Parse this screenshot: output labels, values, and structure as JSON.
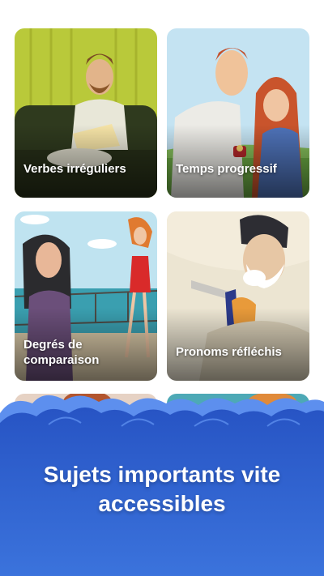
{
  "cards": [
    {
      "label": "Verbes irréguliers",
      "image": "man-reading-book-on-sofa"
    },
    {
      "label": "Temps progressif",
      "image": "man-proposing-ring-to-woman"
    },
    {
      "label": "Degrés de\ncomparaison",
      "image": "two-women-on-ship-deck"
    },
    {
      "label": "Pronoms réfléchis",
      "image": "man-shaving-with-razor"
    },
    {
      "label": "",
      "image": "partial-card-orange"
    },
    {
      "label": "",
      "image": "partial-card-teal"
    }
  ],
  "banner": {
    "title_line1": "Sujets importants vite",
    "title_line2": "accessibles"
  },
  "colors": {
    "banner_blue": "#2f5fcf",
    "banner_light": "#5b8ef0"
  }
}
